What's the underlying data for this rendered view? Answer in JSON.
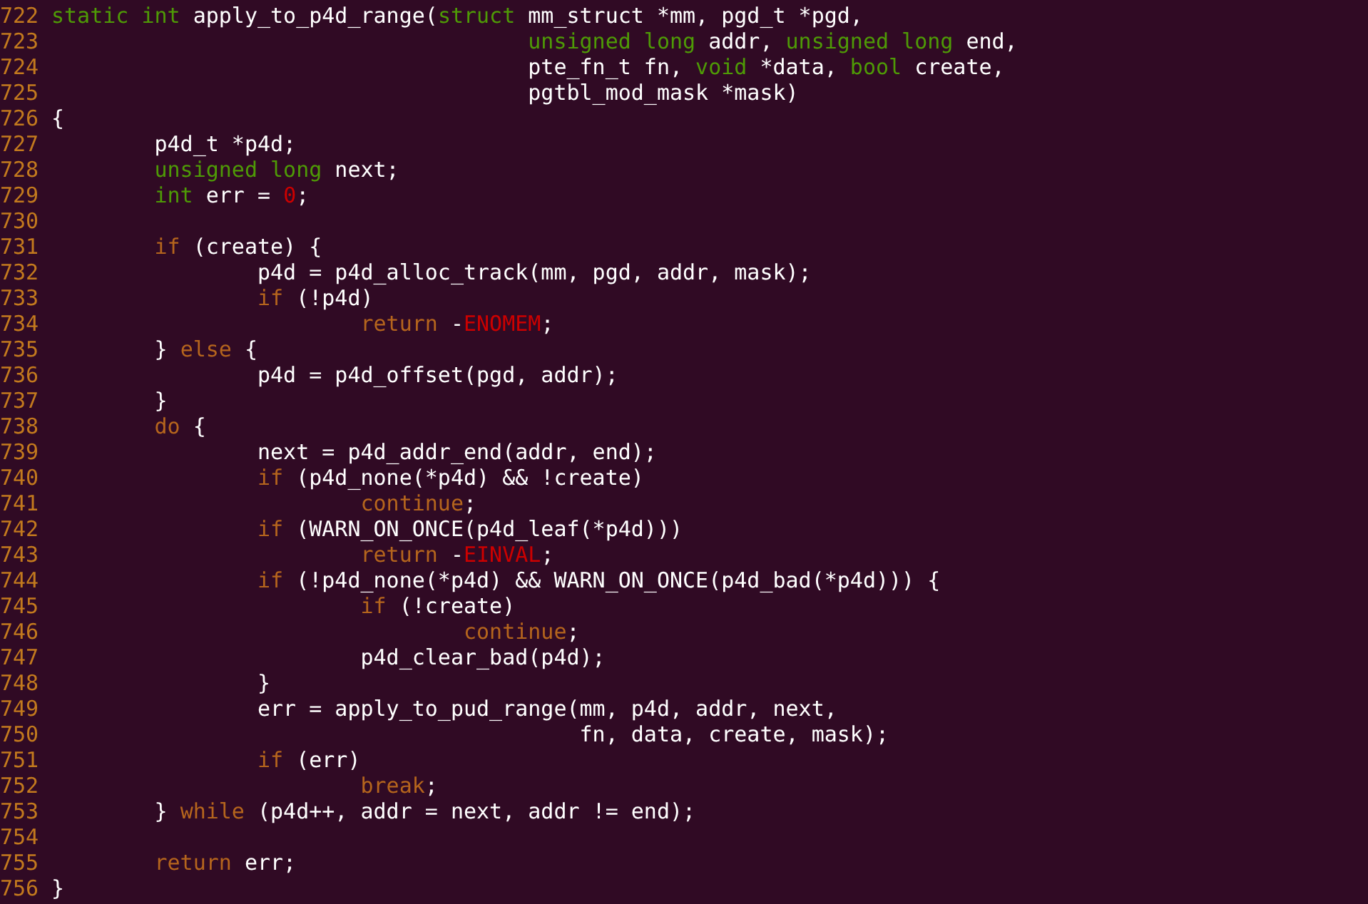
{
  "lines": [
    {
      "number": "722",
      "segments": [
        {
          "kind": "type",
          "text": "static int"
        },
        {
          "kind": "plain",
          "text": " apply_to_p4d_range("
        },
        {
          "kind": "type",
          "text": "struct"
        },
        {
          "kind": "plain",
          "text": " mm_struct *mm, pgd_t *pgd,"
        }
      ]
    },
    {
      "number": "723",
      "segments": [
        {
          "kind": "type",
          "text": "                                     unsigned long"
        },
        {
          "kind": "plain",
          "text": " addr, "
        },
        {
          "kind": "type",
          "text": "unsigned long"
        },
        {
          "kind": "plain",
          "text": " end,"
        }
      ]
    },
    {
      "number": "724",
      "segments": [
        {
          "kind": "plain",
          "text": "                                     pte_fn_t fn, "
        },
        {
          "kind": "type",
          "text": "void"
        },
        {
          "kind": "plain",
          "text": " *data, "
        },
        {
          "kind": "type",
          "text": "bool"
        },
        {
          "kind": "plain",
          "text": " create,"
        }
      ]
    },
    {
      "number": "725",
      "segments": [
        {
          "kind": "plain",
          "text": "                                     pgtbl_mod_mask *mask)"
        }
      ]
    },
    {
      "number": "726",
      "segments": [
        {
          "kind": "plain",
          "text": "{"
        }
      ]
    },
    {
      "number": "727",
      "segments": [
        {
          "kind": "plain",
          "text": "        p4d_t *p4d;"
        }
      ]
    },
    {
      "number": "728",
      "segments": [
        {
          "kind": "type",
          "text": "        unsigned long"
        },
        {
          "kind": "plain",
          "text": " next;"
        }
      ]
    },
    {
      "number": "729",
      "segments": [
        {
          "kind": "type",
          "text": "        int"
        },
        {
          "kind": "plain",
          "text": " err = "
        },
        {
          "kind": "constant",
          "text": "0"
        },
        {
          "kind": "plain",
          "text": ";"
        }
      ]
    },
    {
      "number": "730"
    },
    {
      "number": "731",
      "segments": [
        {
          "kind": "keyword",
          "text": "        if"
        },
        {
          "kind": "plain",
          "text": " (create) {"
        }
      ]
    },
    {
      "number": "732",
      "segments": [
        {
          "kind": "plain",
          "text": "                p4d = p4d_alloc_track(mm, pgd, addr, mask);"
        }
      ]
    },
    {
      "number": "733",
      "segments": [
        {
          "kind": "keyword",
          "text": "                if"
        },
        {
          "kind": "plain",
          "text": " (!p4d)"
        }
      ]
    },
    {
      "number": "734",
      "segments": [
        {
          "kind": "keyword",
          "text": "                        return"
        },
        {
          "kind": "plain",
          "text": " -"
        },
        {
          "kind": "constant",
          "text": "ENOMEM"
        },
        {
          "kind": "plain",
          "text": ";"
        }
      ]
    },
    {
      "number": "735",
      "segments": [
        {
          "kind": "plain",
          "text": "        } "
        },
        {
          "kind": "keyword",
          "text": "else"
        },
        {
          "kind": "plain",
          "text": " {"
        }
      ]
    },
    {
      "number": "736",
      "segments": [
        {
          "kind": "plain",
          "text": "                p4d = p4d_offset(pgd, addr);"
        }
      ]
    },
    {
      "number": "737",
      "segments": [
        {
          "kind": "plain",
          "text": "        }"
        }
      ]
    },
    {
      "number": "738",
      "segments": [
        {
          "kind": "keyword",
          "text": "        do"
        },
        {
          "kind": "plain",
          "text": " {"
        }
      ]
    },
    {
      "number": "739",
      "segments": [
        {
          "kind": "plain",
          "text": "                next = p4d_addr_end(addr, end);"
        }
      ]
    },
    {
      "number": "740",
      "segments": [
        {
          "kind": "keyword",
          "text": "                if"
        },
        {
          "kind": "plain",
          "text": " (p4d_none(*p4d) && !create)"
        }
      ]
    },
    {
      "number": "741",
      "segments": [
        {
          "kind": "keyword",
          "text": "                        continue"
        },
        {
          "kind": "plain",
          "text": ";"
        }
      ]
    },
    {
      "number": "742",
      "segments": [
        {
          "kind": "keyword",
          "text": "                if"
        },
        {
          "kind": "plain",
          "text": " (WARN_ON_ONCE(p4d_leaf(*p4d)))"
        }
      ]
    },
    {
      "number": "743",
      "segments": [
        {
          "kind": "keyword",
          "text": "                        return"
        },
        {
          "kind": "plain",
          "text": " -"
        },
        {
          "kind": "constant",
          "text": "EINVAL"
        },
        {
          "kind": "plain",
          "text": ";"
        }
      ]
    },
    {
      "number": "744",
      "segments": [
        {
          "kind": "keyword",
          "text": "                if"
        },
        {
          "kind": "plain",
          "text": " (!p4d_none(*p4d) && WARN_ON_ONCE(p4d_bad(*p4d))) {"
        }
      ]
    },
    {
      "number": "745",
      "segments": [
        {
          "kind": "keyword",
          "text": "                        if"
        },
        {
          "kind": "plain",
          "text": " (!create)"
        }
      ]
    },
    {
      "number": "746",
      "segments": [
        {
          "kind": "keyword",
          "text": "                                continue"
        },
        {
          "kind": "plain",
          "text": ";"
        }
      ]
    },
    {
      "number": "747",
      "segments": [
        {
          "kind": "plain",
          "text": "                        p4d_clear_bad(p4d);"
        }
      ]
    },
    {
      "number": "748",
      "segments": [
        {
          "kind": "plain",
          "text": "                }"
        }
      ]
    },
    {
      "number": "749",
      "segments": [
        {
          "kind": "plain",
          "text": "                err = apply_to_pud_range(mm, p4d, addr, next,"
        }
      ]
    },
    {
      "number": "750",
      "segments": [
        {
          "kind": "plain",
          "text": "                                         fn, data, create, mask);"
        }
      ]
    },
    {
      "number": "751",
      "segments": [
        {
          "kind": "keyword",
          "text": "                if"
        },
        {
          "kind": "plain",
          "text": " (err)"
        }
      ]
    },
    {
      "number": "752",
      "segments": [
        {
          "kind": "keyword",
          "text": "                        break"
        },
        {
          "kind": "plain",
          "text": ";"
        }
      ]
    },
    {
      "number": "753",
      "segments": [
        {
          "kind": "plain",
          "text": "        } "
        },
        {
          "kind": "keyword",
          "text": "while"
        },
        {
          "kind": "plain",
          "text": " (p4d++, addr = next, addr != end);"
        }
      ]
    },
    {
      "number": "754"
    },
    {
      "number": "755",
      "segments": [
        {
          "kind": "keyword",
          "text": "        return"
        },
        {
          "kind": "plain",
          "text": " err;"
        }
      ]
    },
    {
      "number": "756",
      "segments": [
        {
          "kind": "plain",
          "text": "}"
        }
      ]
    }
  ]
}
